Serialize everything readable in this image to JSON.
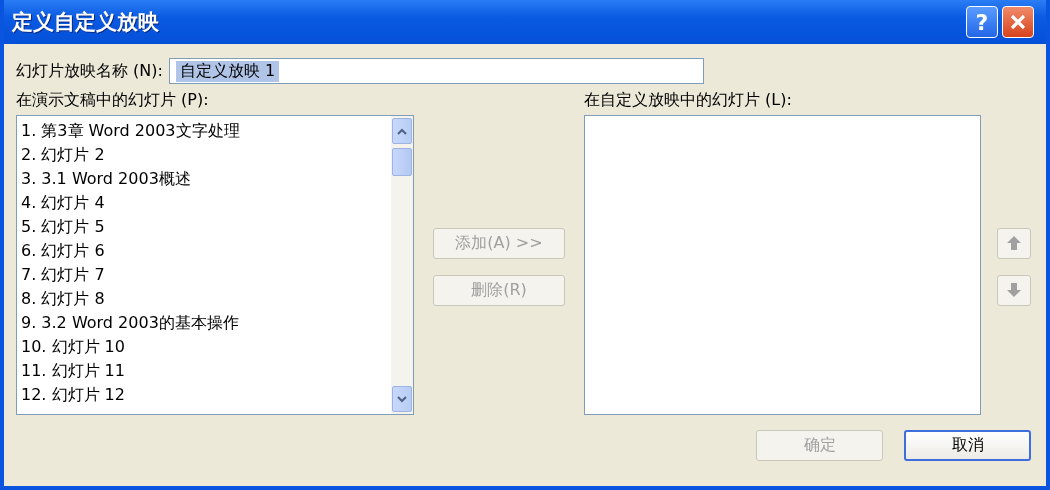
{
  "window": {
    "title": "定义自定义放映",
    "help_button": "?"
  },
  "show_name": {
    "label": "幻灯片放映名称 (N):",
    "value": "自定义放映 1",
    "value_selected": true
  },
  "presentation_slides": {
    "label": "在演示文稿中的幻灯片 (P):",
    "items": [
      {
        "text": "1. 第3章 Word 2003文字处理"
      },
      {
        "text": "2. 幻灯片 2"
      },
      {
        "text": "3. 3.1 Word 2003概述"
      },
      {
        "text": "4. 幻灯片 4"
      },
      {
        "text": "5. 幻灯片 5"
      },
      {
        "text": "6. 幻灯片 6"
      },
      {
        "text": "7. 幻灯片 7"
      },
      {
        "text": "8. 幻灯片 8"
      },
      {
        "text": "9. 3.2 Word 2003的基本操作"
      },
      {
        "text": "10. 幻灯片 10"
      },
      {
        "text": "11. 幻灯片 11"
      },
      {
        "text": "12. 幻灯片 12"
      }
    ]
  },
  "middle_buttons": [
    {
      "label": "添加(A) >>",
      "disabled": true
    },
    {
      "label": "删除(R)",
      "disabled": true
    }
  ],
  "custom_show_slides": {
    "label": "在自定义放映中的幻灯片 (L):"
  },
  "order_buttons": [
    {
      "kind": "up",
      "disabled": true
    },
    {
      "kind": "down",
      "disabled": true
    }
  ],
  "dialog_buttons": [
    {
      "label": "确定",
      "disabled": true,
      "default": false
    },
    {
      "label": "取消",
      "disabled": false,
      "default": true
    }
  ]
}
